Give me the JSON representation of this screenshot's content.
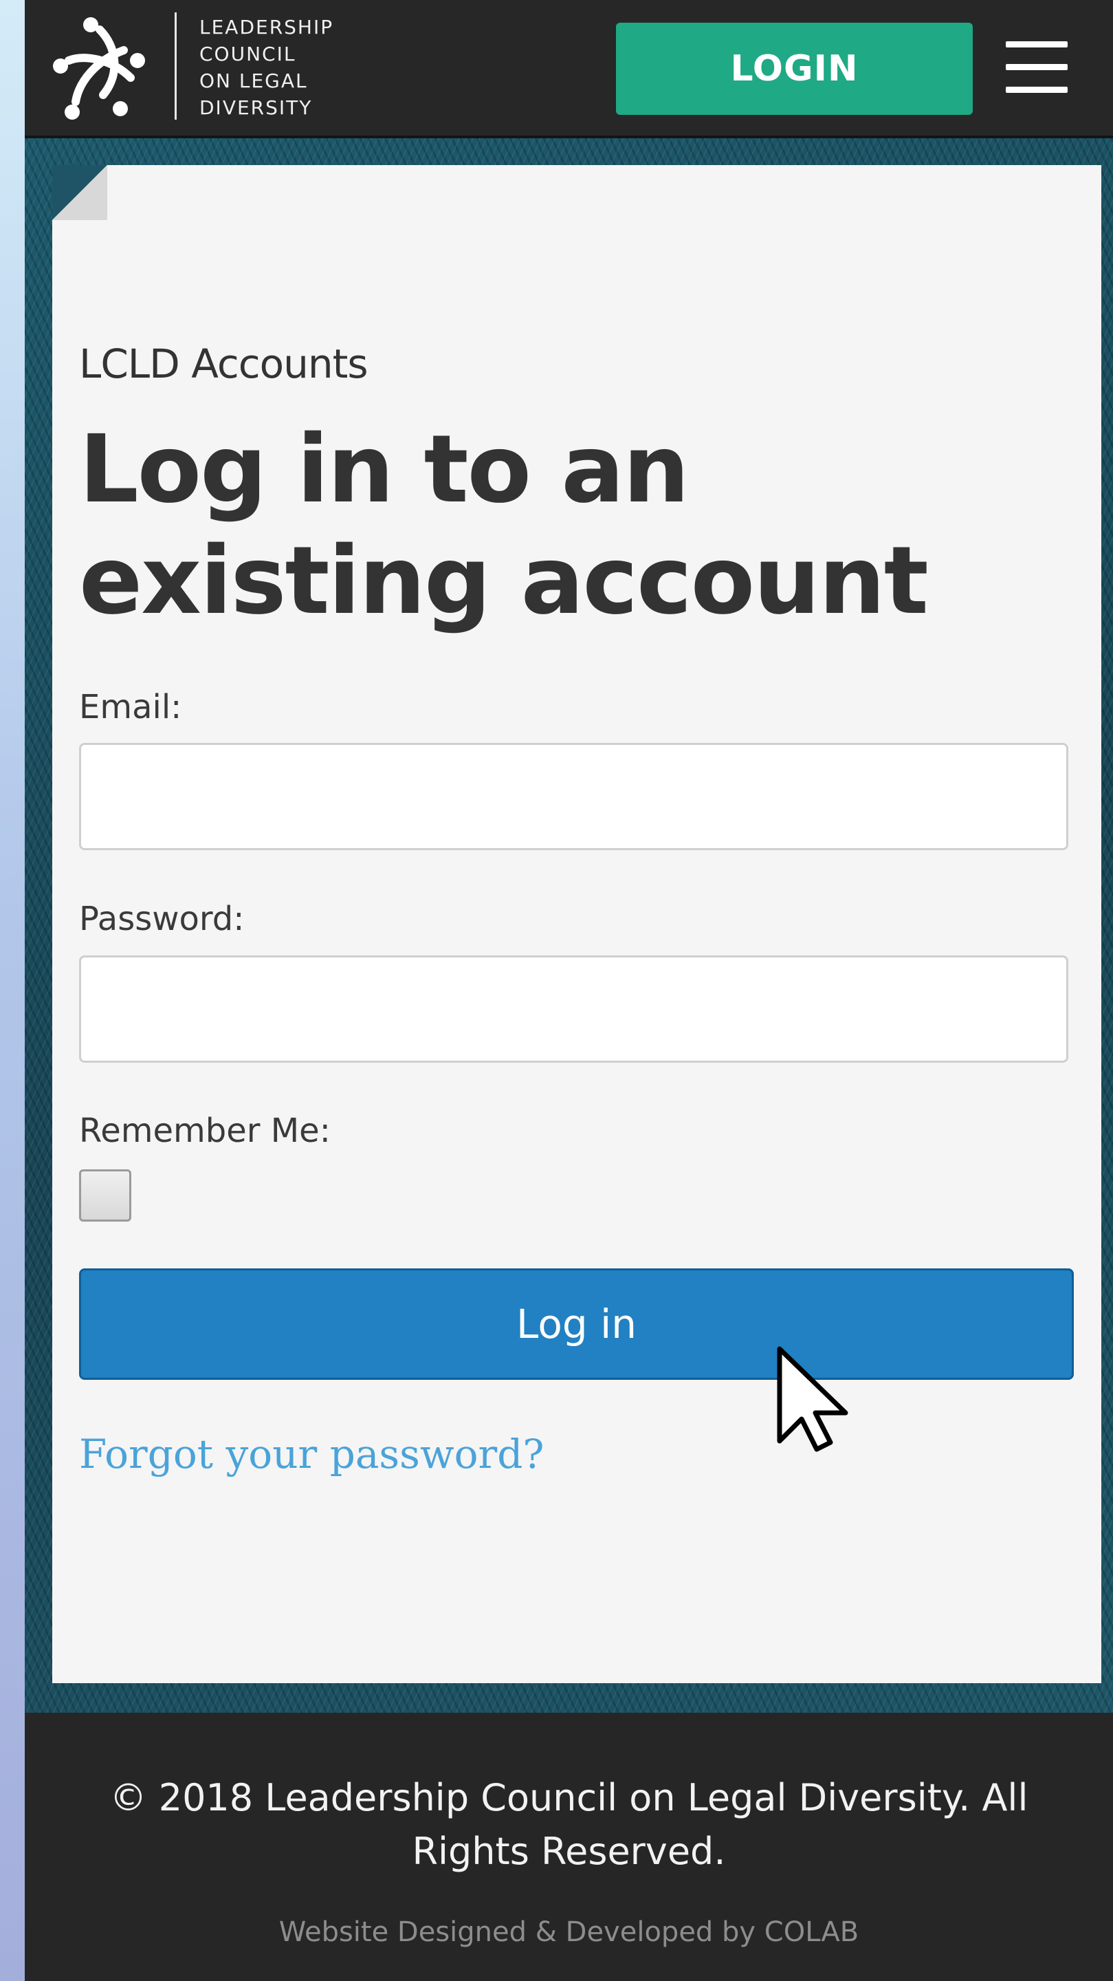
{
  "header": {
    "logo_lines": [
      "LEADERSHIP",
      "COUNCIL",
      "ON LEGAL",
      "DIVERSITY"
    ],
    "login_label": "LOGIN",
    "menu_icon": "hamburger-menu-icon"
  },
  "main": {
    "subtitle": "LCLD Accounts",
    "title": "Log in to an existing account",
    "form": {
      "email_label": "Email:",
      "email_value": "",
      "password_label": "Password:",
      "password_value": "",
      "remember_label": "Remember Me:",
      "remember_checked": false,
      "submit_label": "Log in",
      "forgot_label": "Forgot your password?"
    }
  },
  "footer": {
    "copyright": "© 2018 Leadership Council on Legal Diversity. All Rights Reserved.",
    "credit": "Website Designed & Developed by COLAB"
  },
  "colors": {
    "header_bg": "#272727",
    "login_button": "#1fa984",
    "submit_button": "#2181c2",
    "link": "#4aa3d9",
    "footer_bg": "#262626"
  }
}
